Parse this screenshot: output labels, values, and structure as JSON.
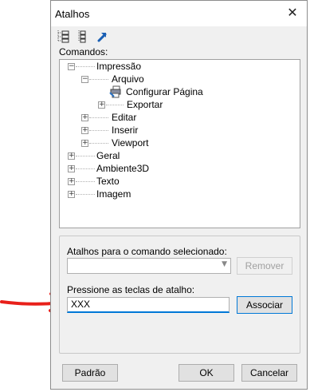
{
  "window": {
    "title": "Atalhos",
    "close_glyph": "✕"
  },
  "toolbar": {
    "icons": [
      "expand-tree-icon",
      "collapse-tree-icon",
      "export-icon"
    ]
  },
  "commands_label": "Comandos:",
  "tree": {
    "impressao": "Impressão",
    "arquivo": "Arquivo",
    "configurar": "Configurar Página",
    "exportar": "Exportar",
    "editar": "Editar",
    "inserir": "Inserir",
    "viewport": "Viewport",
    "geral": "Geral",
    "ambiente3d": "Ambiente3D",
    "texto": "Texto",
    "imagem": "Imagem"
  },
  "shortcuts": {
    "label": "Atalhos para o comando selecionado:",
    "remove_button": "Remover"
  },
  "hotkey": {
    "label": "Pressione as teclas de atalho:",
    "value": "XXX",
    "assign_button": "Associar"
  },
  "footer": {
    "default_button": "Padrão",
    "ok_button": "OK",
    "cancel_button": "Cancelar"
  },
  "colors": {
    "accent": "#0078d7",
    "arrow": "#e8201a"
  }
}
